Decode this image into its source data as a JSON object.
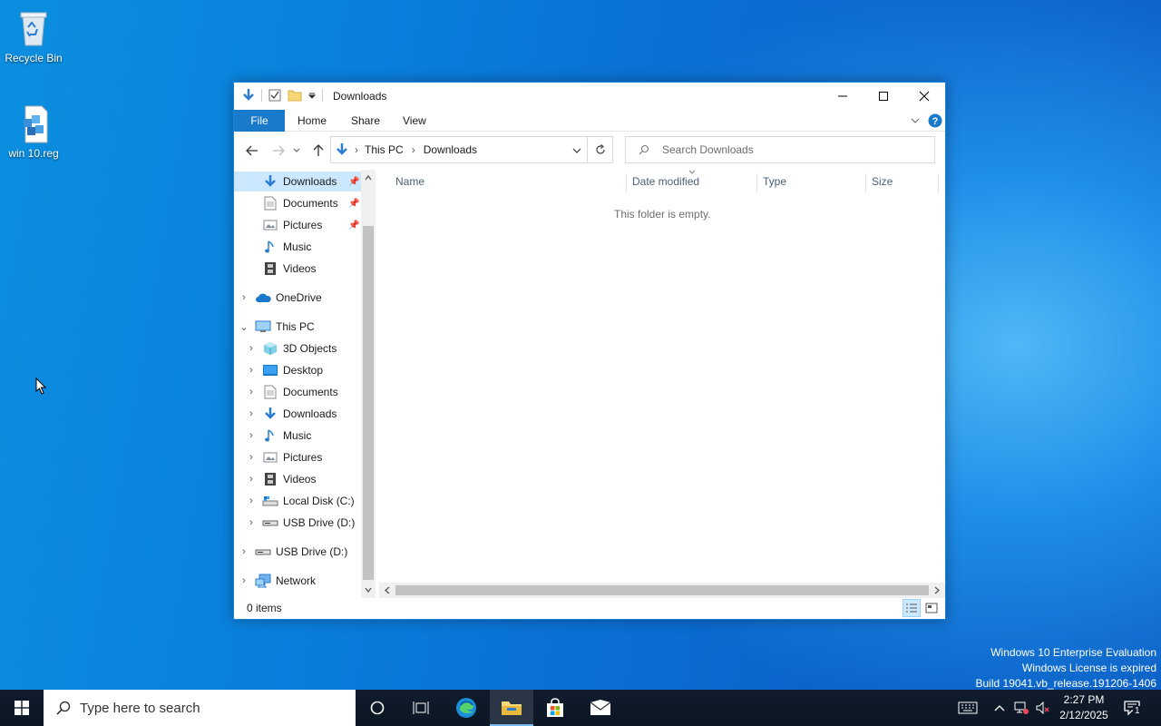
{
  "desktop": {
    "icons": [
      {
        "label": "Recycle Bin",
        "icon": "recycle-bin-icon"
      },
      {
        "label": "win 10.reg",
        "icon": "registry-file-icon"
      }
    ]
  },
  "window": {
    "title": "Downloads",
    "ribbon_tabs": [
      "File",
      "Home",
      "Share",
      "View"
    ],
    "address": {
      "crumbs": [
        "This PC",
        "Downloads"
      ]
    },
    "search_placeholder": "Search Downloads",
    "nav": {
      "quick_access": [
        {
          "label": "Downloads",
          "icon": "download-arrow-icon",
          "pinned": true,
          "selected": true
        },
        {
          "label": "Documents",
          "icon": "document-icon",
          "pinned": true
        },
        {
          "label": "Pictures",
          "icon": "pictures-icon",
          "pinned": true
        },
        {
          "label": "Music",
          "icon": "music-note-icon"
        },
        {
          "label": "Videos",
          "icon": "film-icon"
        }
      ],
      "onedrive": "OneDrive",
      "this_pc": "This PC",
      "this_pc_children": [
        {
          "label": "3D Objects",
          "icon": "cube-icon"
        },
        {
          "label": "Desktop",
          "icon": "desktop-folder-icon"
        },
        {
          "label": "Documents",
          "icon": "document-icon"
        },
        {
          "label": "Downloads",
          "icon": "download-arrow-icon"
        },
        {
          "label": "Music",
          "icon": "music-note-icon"
        },
        {
          "label": "Pictures",
          "icon": "pictures-icon"
        },
        {
          "label": "Videos",
          "icon": "film-icon"
        },
        {
          "label": "Local Disk (C:)",
          "icon": "local-disk-icon"
        },
        {
          "label": "USB Drive (D:)",
          "icon": "usb-drive-icon"
        }
      ],
      "usb_drive": "USB Drive (D:)",
      "network": "Network"
    },
    "columns": [
      "Name",
      "Date modified",
      "Type",
      "Size"
    ],
    "empty_message": "This folder is empty.",
    "status": "0 items"
  },
  "watermark": {
    "line1": "Windows 10 Enterprise Evaluation",
    "line2": "Windows License is expired",
    "line3": "Build 19041.vb_release.191206-1406"
  },
  "taskbar": {
    "search_placeholder": "Type here to search",
    "time": "2:27 PM",
    "date": "2/12/2025",
    "notification_count": "1"
  },
  "colors": {
    "accent": "#1979ca",
    "selection": "#cce8ff",
    "taskbar": "#101c2c"
  }
}
